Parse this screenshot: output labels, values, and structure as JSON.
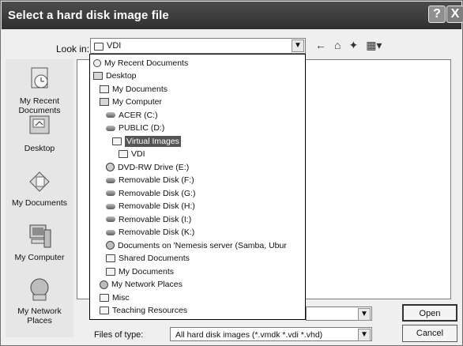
{
  "window": {
    "title": "Select a hard disk image file"
  },
  "titlebar": {
    "help_glyph": "?",
    "close_glyph": "X"
  },
  "lookin": {
    "label": "Look in:",
    "value": "VDI"
  },
  "toolbar": {
    "back_glyph": "←",
    "up_glyph": "⌂",
    "newfolder_glyph": "✦",
    "views_glyph": "▦▾"
  },
  "places": [
    {
      "label": "My Recent Documents",
      "icon": "recent-documents-icon"
    },
    {
      "label": "Desktop",
      "icon": "desktop-icon"
    },
    {
      "label": "My Documents",
      "icon": "my-documents-icon"
    },
    {
      "label": "My Computer",
      "icon": "my-computer-icon"
    },
    {
      "label": "My Network Places",
      "icon": "network-places-icon"
    }
  ],
  "dropdown_items": [
    {
      "label": "My Recent Documents",
      "icon": "recent",
      "indent": 0
    },
    {
      "label": "Desktop",
      "icon": "desktop",
      "indent": 0
    },
    {
      "label": "My Documents",
      "icon": "docs",
      "indent": 1
    },
    {
      "label": "My Computer",
      "icon": "computer",
      "indent": 1
    },
    {
      "label": "ACER (C:)",
      "icon": "drive",
      "indent": 2
    },
    {
      "label": "PUBLIC (D:)",
      "icon": "drive",
      "indent": 2
    },
    {
      "label": "Virtual Images",
      "icon": "folder",
      "indent": 3,
      "selected": true
    },
    {
      "label": "VDI",
      "icon": "folder",
      "indent": 4
    },
    {
      "label": "DVD-RW Drive (E:)",
      "icon": "dvd",
      "indent": 2
    },
    {
      "label": "Removable Disk (F:)",
      "icon": "drive",
      "indent": 2
    },
    {
      "label": "Removable Disk (G:)",
      "icon": "drive",
      "indent": 2
    },
    {
      "label": "Removable Disk (H:)",
      "icon": "drive",
      "indent": 2
    },
    {
      "label": "Removable Disk (I:)",
      "icon": "drive",
      "indent": 2
    },
    {
      "label": "Removable Disk (K:)",
      "icon": "drive",
      "indent": 2
    },
    {
      "label": "Documents on 'Nemesis server (Samba, Ubur",
      "icon": "net",
      "indent": 2
    },
    {
      "label": "Shared Documents",
      "icon": "folder",
      "indent": 2
    },
    {
      "label": "My Documents",
      "icon": "folder",
      "indent": 2
    },
    {
      "label": "My Network Places",
      "icon": "net",
      "indent": 1
    },
    {
      "label": "Misc",
      "icon": "folder",
      "indent": 1
    },
    {
      "label": "Teaching Resources",
      "icon": "folder",
      "indent": 1
    }
  ],
  "filetype": {
    "label": "Files of type:",
    "value": "All hard disk images (*.vmdk *.vdi *.vhd)"
  },
  "buttons": {
    "open": "Open",
    "cancel": "Cancel"
  }
}
